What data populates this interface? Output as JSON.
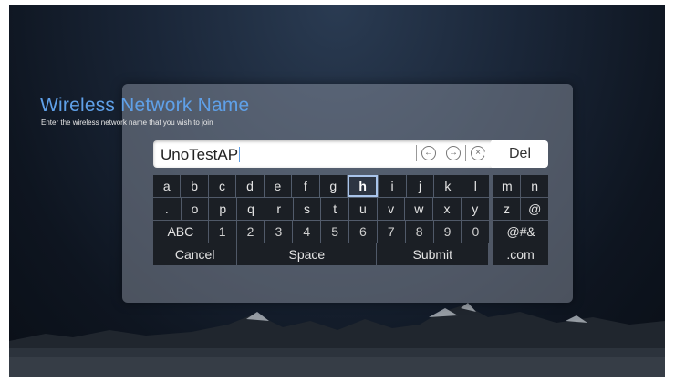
{
  "dialog": {
    "title": "Wireless Network Name",
    "subtitle": "Enter the wireless network name that you wish to join"
  },
  "input": {
    "value": "UnoTestAP",
    "icons": [
      "arrow-left-circle-icon",
      "arrow-right-circle-icon",
      "clear-circle-icon"
    ]
  },
  "keys": {
    "del": "Del",
    "row1": [
      "a",
      "b",
      "c",
      "d",
      "e",
      "f",
      "g",
      "h",
      "i",
      "j",
      "k",
      "l",
      "m",
      "n"
    ],
    "row2": [
      ".",
      "o",
      "p",
      "q",
      "r",
      "s",
      "t",
      "u",
      "v",
      "w",
      "x",
      "y",
      "z",
      "@"
    ],
    "row3": [
      "ABC",
      "1",
      "2",
      "3",
      "4",
      "5",
      "6",
      "7",
      "8",
      "9",
      "0",
      "@#&"
    ],
    "row4": [
      "Cancel",
      "Space",
      "Submit",
      ".com"
    ],
    "selected": "h"
  },
  "colors": {
    "title": "#5fa0e8",
    "key_bg": "#1b1f25",
    "selected_border": "#a9c4ea"
  }
}
